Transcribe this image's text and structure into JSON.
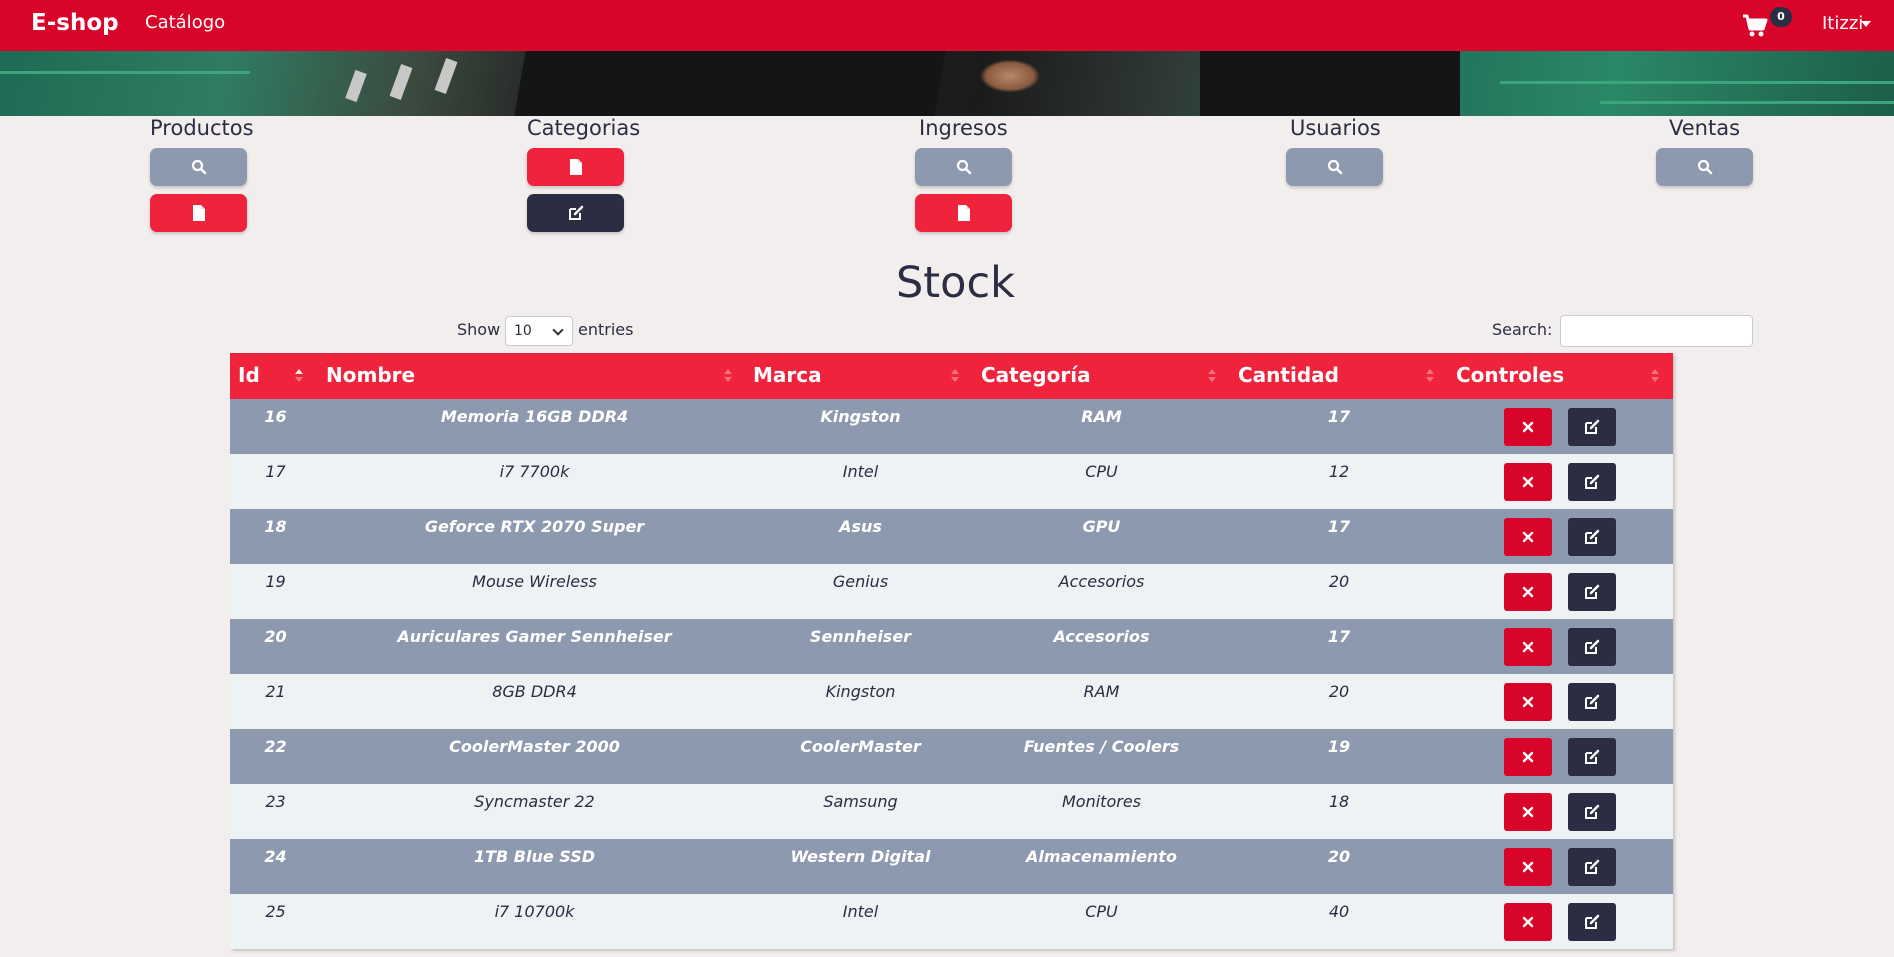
{
  "navbar": {
    "brand": "E-shop",
    "link_catalogo": "Catálogo",
    "cart_count": "0",
    "user_name": "Itizzi",
    "bg_color": "#d90429"
  },
  "admin_sections": [
    {
      "title": "Productos",
      "buttons": [
        {
          "icon": "search-icon",
          "color": "grey"
        },
        {
          "icon": "file-icon",
          "color": "red"
        }
      ]
    },
    {
      "title": "Categorias",
      "buttons": [
        {
          "icon": "file-icon",
          "color": "red"
        },
        {
          "icon": "edit-icon",
          "color": "dark"
        }
      ]
    },
    {
      "title": "Ingresos",
      "buttons": [
        {
          "icon": "search-icon",
          "color": "grey"
        },
        {
          "icon": "file-icon",
          "color": "red"
        }
      ]
    },
    {
      "title": "Usuarios",
      "buttons": [
        {
          "icon": "search-icon",
          "color": "grey"
        }
      ]
    },
    {
      "title": "Ventas",
      "buttons": [
        {
          "icon": "search-icon",
          "color": "grey"
        }
      ]
    }
  ],
  "stock": {
    "title": "Stock",
    "show_label": "Show",
    "entries_value": "10",
    "entries_label": "entries",
    "search_label": "Search:",
    "search_value": "",
    "columns": [
      "Id",
      "Nombre",
      "Marca",
      "Categoría",
      "Cantidad",
      "Controles"
    ],
    "rows": [
      {
        "id": "16",
        "nombre": "Memoria 16GB DDR4",
        "marca": "Kingston",
        "categoria": "RAM",
        "cantidad": "17"
      },
      {
        "id": "17",
        "nombre": "i7 7700k",
        "marca": "Intel",
        "categoria": "CPU",
        "cantidad": "12"
      },
      {
        "id": "18",
        "nombre": "Geforce RTX 2070 Super",
        "marca": "Asus",
        "categoria": "GPU",
        "cantidad": "17"
      },
      {
        "id": "19",
        "nombre": "Mouse Wireless",
        "marca": "Genius",
        "categoria": "Accesorios",
        "cantidad": "20"
      },
      {
        "id": "20",
        "nombre": "Auriculares Gamer Sennheiser",
        "marca": "Sennheiser",
        "categoria": "Accesorios",
        "cantidad": "17"
      },
      {
        "id": "21",
        "nombre": "8GB DDR4",
        "marca": "Kingston",
        "categoria": "RAM",
        "cantidad": "20"
      },
      {
        "id": "22",
        "nombre": "CoolerMaster 2000",
        "marca": "CoolerMaster",
        "categoria": "Fuentes / Coolers",
        "cantidad": "19"
      },
      {
        "id": "23",
        "nombre": "Syncmaster 22",
        "marca": "Samsung",
        "categoria": "Monitores",
        "cantidad": "18"
      },
      {
        "id": "24",
        "nombre": "1TB Blue SSD",
        "marca": "Western Digital",
        "categoria": "Almacenamiento",
        "cantidad": "20"
      },
      {
        "id": "25",
        "nombre": "i7 10700k",
        "marca": "Intel",
        "categoria": "CPU",
        "cantidad": "40"
      }
    ]
  },
  "colors": {
    "primary_red": "#ef233c",
    "dark_red": "#d90429",
    "grey": "#8d99ae",
    "dark": "#2b2d42",
    "light": "#edf2f4",
    "page_bg": "#f3eeee"
  }
}
